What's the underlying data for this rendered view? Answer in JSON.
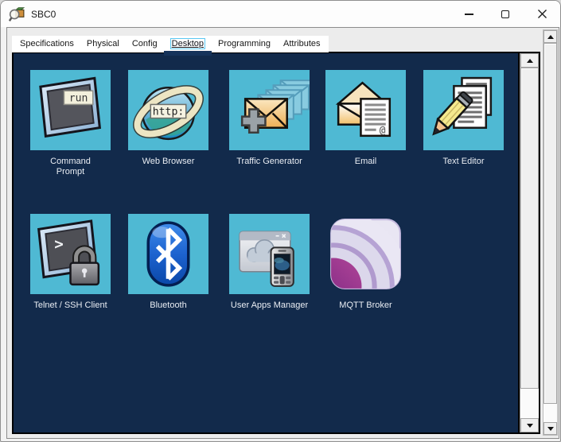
{
  "window": {
    "title": "SBC0",
    "icon": "packet-tracer-device-icon",
    "controls": [
      "minimize-icon",
      "maximize-icon",
      "close-icon"
    ]
  },
  "tabs": [
    {
      "label": "Specifications",
      "active": false
    },
    {
      "label": "Physical",
      "active": false
    },
    {
      "label": "Config",
      "active": false
    },
    {
      "label": "Desktop",
      "active": true
    },
    {
      "label": "Programming",
      "active": false
    },
    {
      "label": "Attributes",
      "active": false
    }
  ],
  "desktop": {
    "apps": [
      {
        "label": "Command\nPrompt",
        "icon": "command-prompt-icon"
      },
      {
        "label": "Web Browser",
        "icon": "web-browser-icon"
      },
      {
        "label": "Traffic Generator",
        "icon": "traffic-generator-icon"
      },
      {
        "label": "Email",
        "icon": "email-icon"
      },
      {
        "label": "Text Editor",
        "icon": "text-editor-icon"
      },
      {
        "label": "Telnet / SSH Client",
        "icon": "telnet-ssh-icon"
      },
      {
        "label": "Bluetooth",
        "icon": "bluetooth-icon"
      },
      {
        "label": "User Apps Manager",
        "icon": "user-apps-manager-icon"
      },
      {
        "label": "MQTT Broker",
        "icon": "mqtt-broker-icon"
      }
    ]
  },
  "icon_texts": {
    "run": "run",
    "http": "http:",
    "prompt": ">"
  },
  "colors": {
    "desktop_background": "#122a4b",
    "tile": "#4fb9d3",
    "active_tab_indicator": "#16335a",
    "focus_box": "#5ac8f2",
    "label_text": "#e9edf3"
  }
}
